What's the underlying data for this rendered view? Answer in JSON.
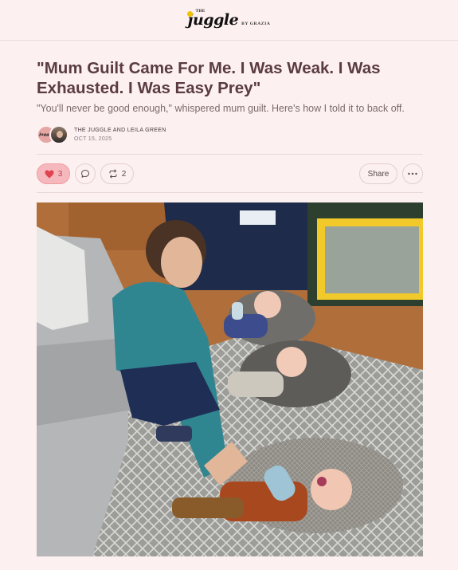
{
  "header": {
    "logo_the": "THE",
    "logo_main": "juggle",
    "logo_by": "BY GRAZIA"
  },
  "article": {
    "title": "\"Mum Guilt Came For Me. I Was Weak. I Was Exhausted. I Was Easy Prey\"",
    "subtitle": "\"You'll never be good enough,\" whispered mum guilt. Here's how I told it to back off.",
    "authors": "THE JUGGLE AND LEILA GREEN",
    "date": "OCT 15, 2025",
    "avatar_text": "juggle"
  },
  "actions": {
    "likes": "3",
    "restacks": "2",
    "share_label": "Share"
  },
  "colors": {
    "background": "#fdf0f0",
    "title": "#5a3b43",
    "like_accent": "#c33d4b"
  },
  "icons": [
    "heart-icon",
    "comment-icon",
    "restack-icon",
    "more-icon"
  ]
}
